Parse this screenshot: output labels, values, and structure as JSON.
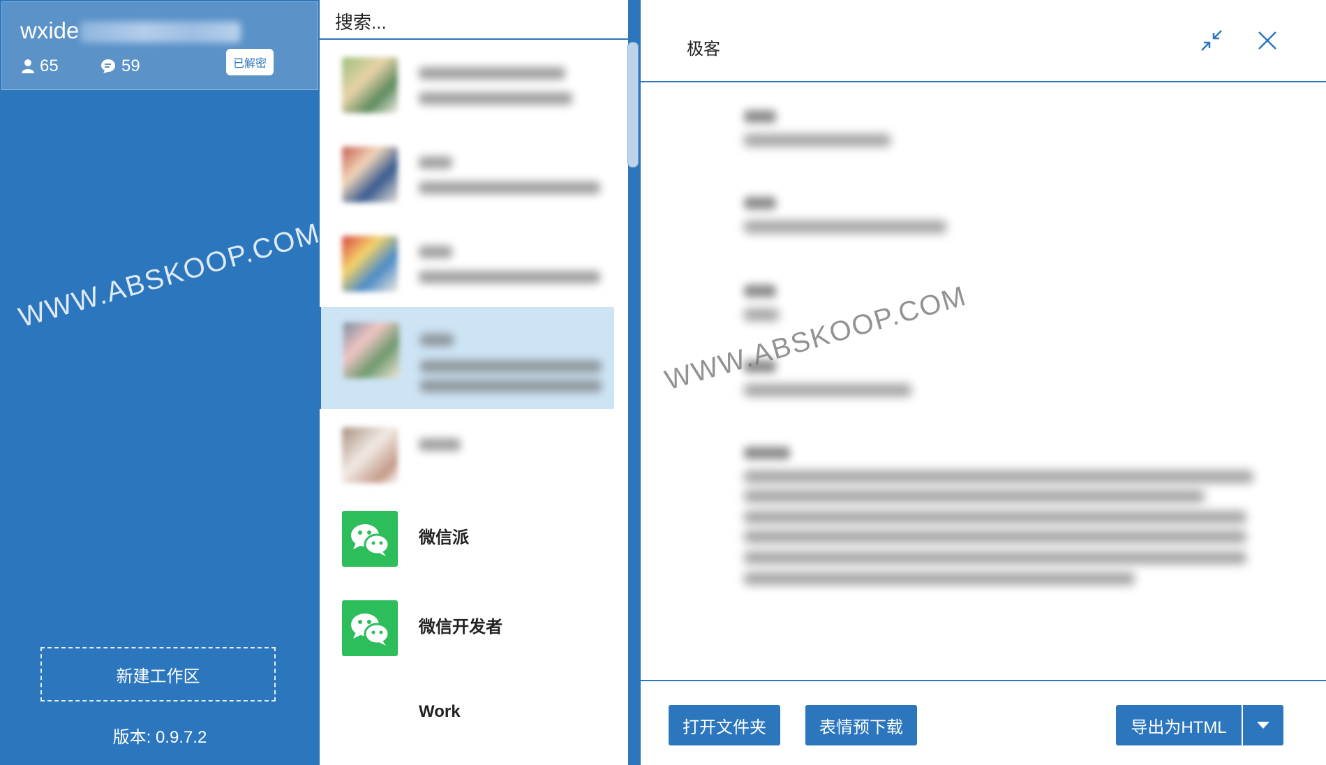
{
  "account": {
    "name": "wxide",
    "members": "65",
    "chats": "59",
    "badge": "已解密"
  },
  "sidebar": {
    "new_workspace": "新建工作区",
    "version": "版本:  0.9.7.2"
  },
  "watermark": "WWW.ABSKOOP.COM",
  "search": {
    "placeholder": "搜索..."
  },
  "chat_list": [
    {
      "name": "",
      "icon": "blurred-photo-avatar"
    },
    {
      "name": "",
      "icon": "blurred-photo-avatar"
    },
    {
      "name": "",
      "icon": "blurred-photo-avatar"
    },
    {
      "name": "",
      "icon": "blurred-photo-avatar",
      "selected": true
    },
    {
      "name": "",
      "icon": "blurred-photo-avatar"
    },
    {
      "name": "微信派",
      "icon": "wechat-icon"
    },
    {
      "name": "微信开发者",
      "icon": "wechat-icon"
    },
    {
      "name": "Work",
      "icon": "none"
    }
  ],
  "detail": {
    "title": "极客",
    "buttons": {
      "open_folder": "打开文件夹",
      "emoji_download": "表情预下载",
      "export_html": "导出为HTML"
    }
  },
  "colors": {
    "primary": "#2b76bd",
    "selected_row": "#cde4f5",
    "wechat_green": "#2dbd5a"
  }
}
